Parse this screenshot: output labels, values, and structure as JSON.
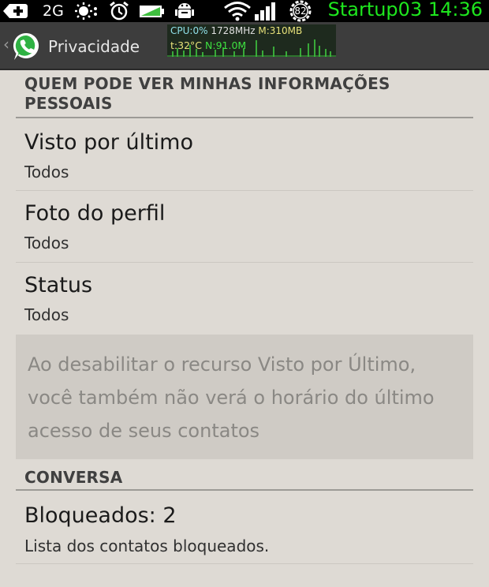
{
  "status_bar": {
    "network": "2G",
    "battery_level": "82",
    "carrier_time": "Startup03 14:36",
    "carrier_color": "#1ee61e"
  },
  "action_bar": {
    "title": "Privacidade",
    "monitor": {
      "cpu_label": "CPU:",
      "cpu_value": "0%",
      "freq": "1728MHz",
      "mem_label": "M:",
      "mem_value": "310MB",
      "temp_label": "t:",
      "temp_value": "32°C",
      "net_label": "N:",
      "net_value": "91.0M"
    }
  },
  "sections": {
    "personal_info_header": "QUEM PODE VER MINHAS INFORMAÇÕES PESSOAIS",
    "last_seen": {
      "title": "Visto por último",
      "value": "Todos"
    },
    "profile_photo": {
      "title": "Foto do perfil",
      "value": "Todos"
    },
    "status": {
      "title": "Status",
      "value": "Todos"
    },
    "info_note": "Ao desabilitar o recurso Visto por Último, você também não verá o horário do último acesso de seus contatos",
    "conversation_header": "CONVERSA",
    "blocked": {
      "title": "Bloqueados: 2",
      "subtitle": "Lista dos contatos bloqueados."
    }
  },
  "colors": {
    "background": "#dedad4",
    "action_bar": "#3d3d3d",
    "whatsapp_green": "#2fb243",
    "monitor_green": "#3ec03e",
    "monitor_yellow": "#e8e27a",
    "monitor_cyan": "#8fe0e8"
  },
  "icons": [
    "plus-box-icon",
    "brightness-icon",
    "alarm-icon",
    "battery-icon",
    "android-debug-icon",
    "wifi-icon",
    "signal-icon",
    "battery-gear-icon",
    "back-chevron-icon",
    "whatsapp-icon"
  ]
}
